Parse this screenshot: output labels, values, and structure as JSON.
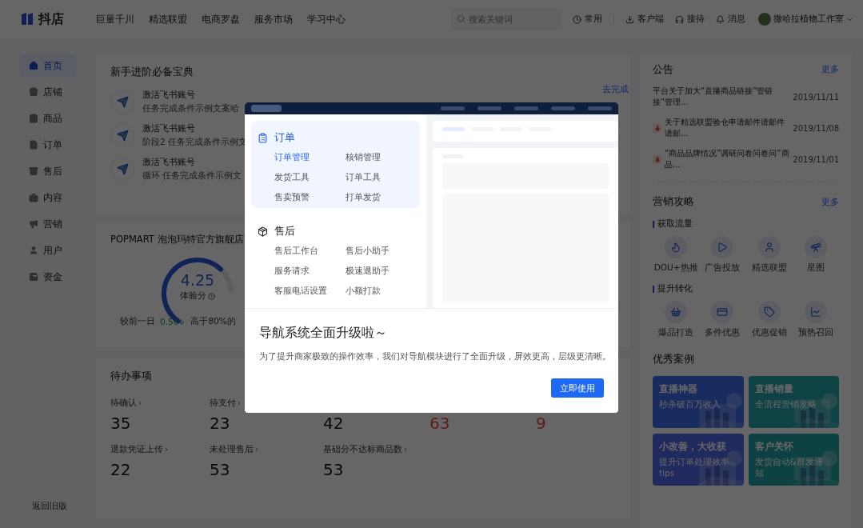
{
  "topbar": {
    "logo": "抖店",
    "nav": [
      "巨量千川",
      "精选联盟",
      "电商罗盘",
      "服务市场",
      "学习中心"
    ],
    "search": {
      "placeholder": "搜索关键词"
    },
    "actions": [
      "常用",
      "客户端",
      "接待",
      "消息"
    ],
    "user": "撒哈拉植物工作室"
  },
  "sidebar": {
    "items": [
      {
        "label": "首页",
        "selected": true
      },
      {
        "label": "店铺",
        "selected": false
      },
      {
        "label": "商品",
        "selected": false
      },
      {
        "label": "订单",
        "selected": false
      },
      {
        "label": "售后",
        "selected": false
      },
      {
        "label": "内容",
        "selected": false
      },
      {
        "label": "营销",
        "selected": false
      },
      {
        "label": "用户",
        "selected": false
      },
      {
        "label": "资金",
        "selected": false
      }
    ],
    "footer": "返回旧版"
  },
  "guide": {
    "title": "新手进阶必备宝典",
    "link": "去完成",
    "tasks": [
      {
        "title": "激活飞书账号",
        "desc": "任务完成条件示例文案哈"
      },
      {
        "title": "激活飞书账号",
        "desc": "阶段2 任务完成条件示例文"
      },
      {
        "title": "激活飞书账号",
        "desc": "循环 任务完成条件示例文"
      }
    ]
  },
  "shop": {
    "name": "POPMART 泡泡玛特官方旗舰店",
    "score": "4.25",
    "score_label": "体验分",
    "level": 0.82,
    "compare": "较前一日",
    "delta": "0.50",
    "rank": "高于80%的"
  },
  "todo": {
    "title": "待办事项",
    "items": [
      {
        "label": "待确认",
        "value": "35",
        "alert": false
      },
      {
        "label": "待支付",
        "value": "23",
        "alert": false
      },
      {
        "value": "42",
        "alert": false
      },
      {
        "value": "63",
        "alert": true
      },
      {
        "value": "9",
        "alert": true
      },
      {
        "label": "退款凭证上传",
        "value": "22",
        "alert": false
      },
      {
        "label": "未处理售后",
        "value": "53",
        "alert": false
      },
      {
        "label": "基础分不达标商品数",
        "value": "53",
        "alert": false
      }
    ]
  },
  "notices": {
    "title": "公告",
    "more": "更多",
    "items": [
      {
        "text": "平台关于加大“直播商品链接”管链接”管理...",
        "date": "2019/11/11",
        "hot": false
      },
      {
        "text": "关于精选联盟验仓申请邮件请邮件请邮...",
        "date": "2019/11/08",
        "hot": true
      },
      {
        "text": "“商品品牌情况”调研问卷问卷问“商品...",
        "date": "2019/11/01",
        "hot": true
      }
    ]
  },
  "marketing": {
    "title": "营销攻略",
    "more": "更多",
    "groups": [
      {
        "title": "获取流量",
        "items": [
          "DOU+热推",
          "广告投放",
          "精选联盟",
          "星图"
        ]
      },
      {
        "title": "提升转化",
        "items": [
          "爆品打造",
          "多件优惠",
          "优惠促销",
          "预热召回"
        ]
      }
    ]
  },
  "cases": {
    "title": "优秀案例",
    "items": [
      {
        "title": "直播神器",
        "subtitle": "秒杀破百万收入"
      },
      {
        "title": "直播销量",
        "subtitle": "全流程营销攻略"
      },
      {
        "title": "小改善，大收获",
        "subtitle": "提升订单处理效率tips"
      },
      {
        "title": "客户关怀",
        "subtitle": "发货自动&群发通知"
      }
    ]
  },
  "modal": {
    "menu": [
      {
        "title": "订单",
        "active": true,
        "items": [
          {
            "label": "订单管理",
            "selected": true
          },
          {
            "label": "核销管理",
            "selected": false
          },
          {
            "label": "发货工具",
            "selected": false
          },
          {
            "label": "订单工具",
            "selected": false
          },
          {
            "label": "售卖预警",
            "selected": false
          },
          {
            "label": "打单发货",
            "selected": false
          }
        ]
      },
      {
        "title": "售后",
        "active": false,
        "items": [
          {
            "label": "售后工作台",
            "selected": false
          },
          {
            "label": "售后小助手",
            "selected": false
          },
          {
            "label": "服务请求",
            "selected": false
          },
          {
            "label": "极速退助手",
            "selected": false
          },
          {
            "label": "客服电话设置",
            "selected": false
          },
          {
            "label": "小额打款",
            "selected": false
          }
        ]
      }
    ],
    "title": "导航系统全面升级啦～",
    "text": "为了提升商家极致的操作效率，我们对导航模块进行了全面升级，屏效更高，层级更清晰。",
    "button": "立即使用"
  }
}
